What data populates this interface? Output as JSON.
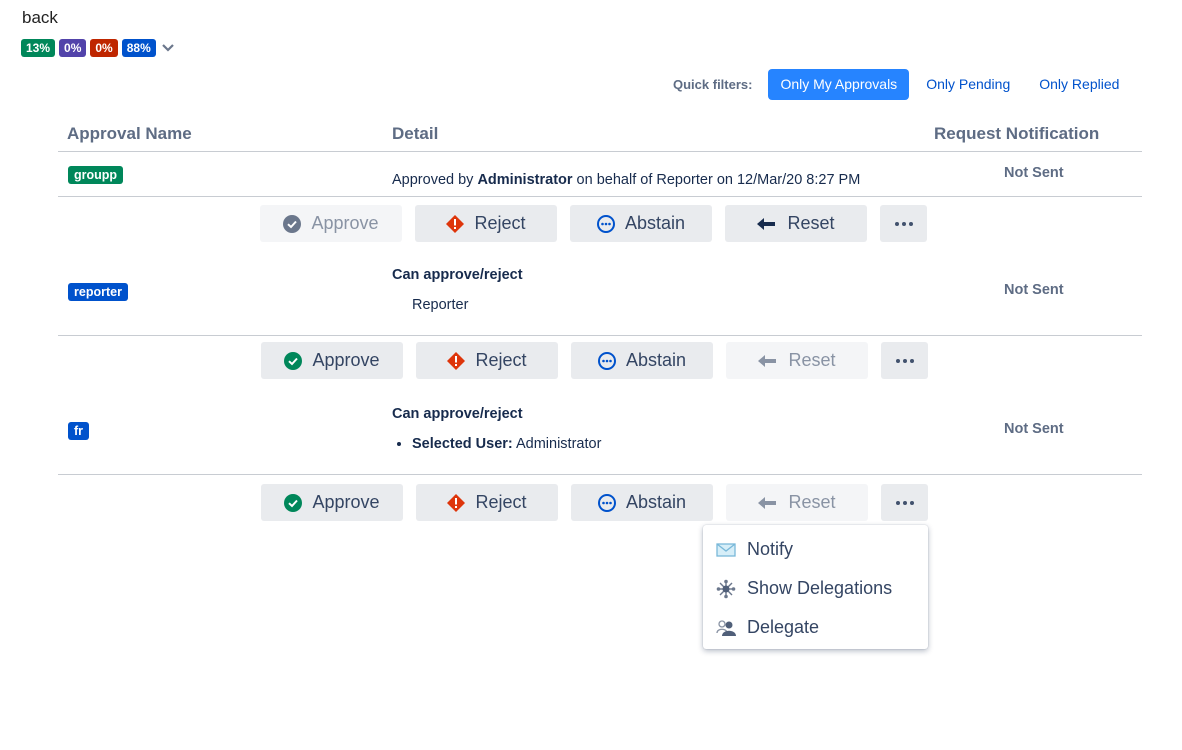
{
  "nav": {
    "back_label": "back"
  },
  "progress_badges": [
    {
      "text": "13%",
      "color": "#00875a"
    },
    {
      "text": "0%",
      "color": "#5243aa"
    },
    {
      "text": "0%",
      "color": "#bf2600"
    },
    {
      "text": "88%",
      "color": "#0052cc"
    }
  ],
  "quick_filters": {
    "label": "Quick filters:",
    "options": [
      "Only My Approvals",
      "Only Pending",
      "Only Replied"
    ],
    "active": "Only My Approvals"
  },
  "table": {
    "headers": [
      "Approval Name",
      "Detail",
      "Request Notification"
    ],
    "rows": [
      {
        "name": "groupp",
        "name_color": "#00875a",
        "detail_pre": "Approved by ",
        "detail_user": "Administrator",
        "detail_post": " on behalf of Reporter on 12/Mar/20 8:27 PM",
        "notification": "Not Sent"
      },
      {
        "name": "reporter",
        "name_color": "#0052cc",
        "detail_heading": "Can approve/reject",
        "detail_value": "Reporter",
        "notification": "Not Sent"
      },
      {
        "name": "fr",
        "name_color": "#0052cc",
        "detail_heading": "Can approve/reject",
        "detail_item_label": "Selected User:",
        "detail_item_value": " Administrator",
        "notification": "Not Sent"
      }
    ]
  },
  "actions": {
    "approve": "Approve",
    "reject": "Reject",
    "abstain": "Abstain",
    "reset": "Reset",
    "more": "more-dots-icon"
  },
  "dropdown_menu": {
    "items": [
      {
        "label": "Notify",
        "icon": "envelope-icon"
      },
      {
        "label": "Show Delegations",
        "icon": "network-icon"
      },
      {
        "label": "Delegate",
        "icon": "delegate-users-icon"
      }
    ]
  },
  "colors": {
    "accent": "#2684ff",
    "approve": "#00875a",
    "reject": "#de350b",
    "abstain": "#0052cc"
  }
}
